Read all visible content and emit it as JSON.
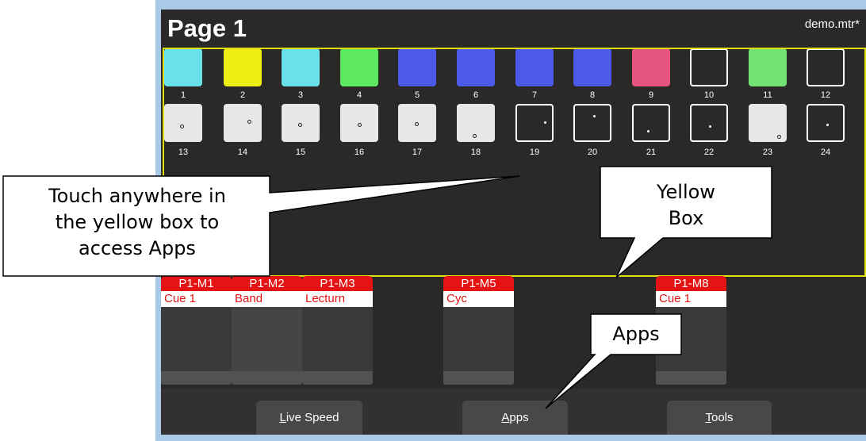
{
  "page_title": "Page 1",
  "file_name": "demo.mtr*",
  "pads_row1": [
    {
      "label": "1",
      "color": "#6ae0e9"
    },
    {
      "label": "2",
      "color": "#eeee14"
    },
    {
      "label": "3",
      "color": "#6ae0e9"
    },
    {
      "label": "4",
      "color": "#5de860"
    },
    {
      "label": "5",
      "color": "#4b5be8"
    },
    {
      "label": "6",
      "color": "#4b5be8"
    },
    {
      "label": "7",
      "color": "#4b5be8"
    },
    {
      "label": "8",
      "color": "#4b5be8"
    },
    {
      "label": "9",
      "color": "#e5537f"
    },
    {
      "label": "10",
      "color": "empty"
    },
    {
      "label": "11",
      "color": "#72e474"
    },
    {
      "label": "12",
      "color": "empty"
    }
  ],
  "pads_row2": [
    {
      "label": "13",
      "style": "grey"
    },
    {
      "label": "14",
      "style": "grey"
    },
    {
      "label": "15",
      "style": "grey"
    },
    {
      "label": "16",
      "style": "grey"
    },
    {
      "label": "17",
      "style": "grey"
    },
    {
      "label": "18",
      "style": "grey"
    },
    {
      "label": "19",
      "style": "empty"
    },
    {
      "label": "20",
      "style": "empty"
    },
    {
      "label": "21",
      "style": "empty"
    },
    {
      "label": "22",
      "style": "empty"
    },
    {
      "label": "23",
      "style": "grey"
    },
    {
      "label": "24",
      "style": "empty"
    }
  ],
  "masters": [
    {
      "name": "P1-M1",
      "cue": "Cue 1"
    },
    {
      "name": "P1-M2",
      "cue": "Band"
    },
    {
      "name": "P1-M3",
      "cue": "Lecturn"
    },
    {
      "name": "P1-M5",
      "cue": "Cyc"
    },
    {
      "name": "P1-M8",
      "cue": "Cue 1"
    }
  ],
  "buttons": {
    "live_speed": {
      "hotkey": "L",
      "rest": "ive Speed"
    },
    "apps": {
      "hotkey": "A",
      "rest": "pps"
    },
    "tools": {
      "hotkey": "T",
      "rest": "ools"
    }
  },
  "callouts": {
    "touch_anywhere": [
      "Touch anywhere in",
      "the yellow box to",
      "access Apps"
    ],
    "yellow_box": [
      "Yellow",
      "Box"
    ],
    "apps": "Apps"
  },
  "colors": {
    "yellow_border": "#e0de11",
    "master_header": "#e51313",
    "screen_bg": "#2b2828"
  }
}
